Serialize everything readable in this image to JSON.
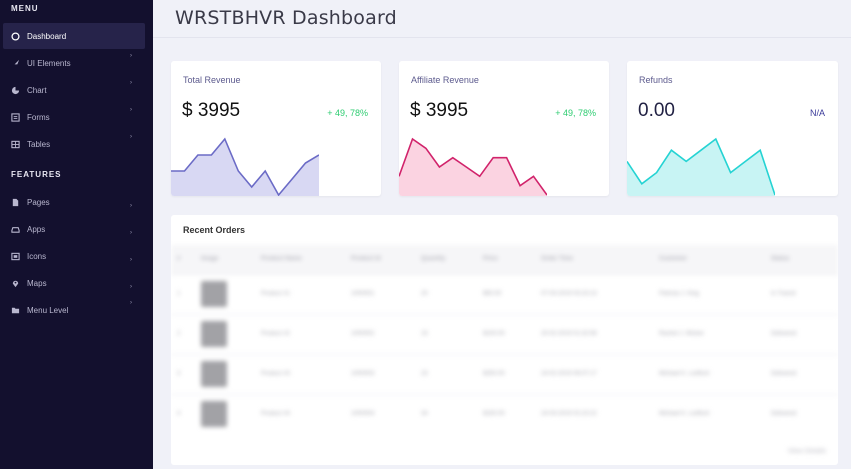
{
  "header": {
    "title": "WRSTBHVR Dashboard"
  },
  "sidebar": {
    "menu_title": "MENU",
    "features_title": "FEATURES",
    "menu_items": [
      {
        "label": "Dashboard",
        "icon": "dashboard-icon",
        "active": true
      },
      {
        "label": "UI Elements",
        "icon": "rocket-icon"
      },
      {
        "label": "Chart",
        "icon": "pie-chart-icon"
      },
      {
        "label": "Forms",
        "icon": "form-icon"
      },
      {
        "label": "Tables",
        "icon": "table-icon"
      }
    ],
    "feature_items": [
      {
        "label": "Pages",
        "icon": "file-icon"
      },
      {
        "label": "Apps",
        "icon": "car-icon"
      },
      {
        "label": "Icons",
        "icon": "icons-icon"
      },
      {
        "label": "Maps",
        "icon": "map-pin-icon"
      },
      {
        "label": "Menu Level",
        "icon": "folder-icon"
      }
    ]
  },
  "cards": [
    {
      "title": "Total Revenue",
      "value": "$ 3995",
      "change": "+ 49, 78%",
      "change_color": "#2ecc71",
      "chart": {
        "type": "area",
        "stroke": "#6b6bc6",
        "fill": "#d8d8f3",
        "values": [
          3,
          3,
          5,
          5,
          7,
          3,
          1,
          3,
          0,
          2,
          4,
          5
        ]
      }
    },
    {
      "title": "Affiliate Revenue",
      "value": "$ 3995",
      "change": "+ 49, 78%",
      "change_color": "#2ecc71",
      "chart": {
        "type": "area",
        "stroke": "#d1236b",
        "fill": "#fbd3e1",
        "values": [
          2,
          6,
          5,
          3,
          4,
          3,
          2,
          4,
          4,
          1,
          2,
          0
        ]
      }
    },
    {
      "title": "Refunds",
      "value": "0.00",
      "change": "N/A",
      "change_color": "#3b3b9a",
      "chart": {
        "type": "area",
        "stroke": "#25d3d3",
        "fill": "#c8f4f4",
        "values": [
          3,
          1,
          2,
          4,
          3,
          4,
          5,
          2,
          3,
          4,
          0
        ]
      }
    }
  ],
  "orders": {
    "title": "Recent Orders",
    "columns": [
      "#",
      "Image",
      "Product Name",
      "Product Id",
      "Quantity",
      "Price",
      "Order Time",
      "Customer",
      "Status"
    ],
    "rows": [
      [
        "1",
        "",
        "Product #1",
        "1000001",
        "20",
        "$50.00",
        "07-03-2019 03:23:13",
        "Patricia J. King",
        "In Transit"
      ],
      [
        "2",
        "",
        "Product #2",
        "1000002",
        "15",
        "$100.00",
        "20-02-2019 01:32:58",
        "Rachel J. Wicker",
        "Delivered"
      ],
      [
        "3",
        "",
        "Product #3",
        "1000003",
        "23",
        "$250.00",
        "24-02-2019 06:07:17",
        "Michael K. Ledford",
        "Delivered"
      ],
      [
        "4",
        "",
        "Product #4",
        "1000004",
        "34",
        "$150.00",
        "24-03-2019 02:10:22",
        "Michael K. Ledford",
        "Delivered"
      ]
    ],
    "view_details": "View Details"
  }
}
